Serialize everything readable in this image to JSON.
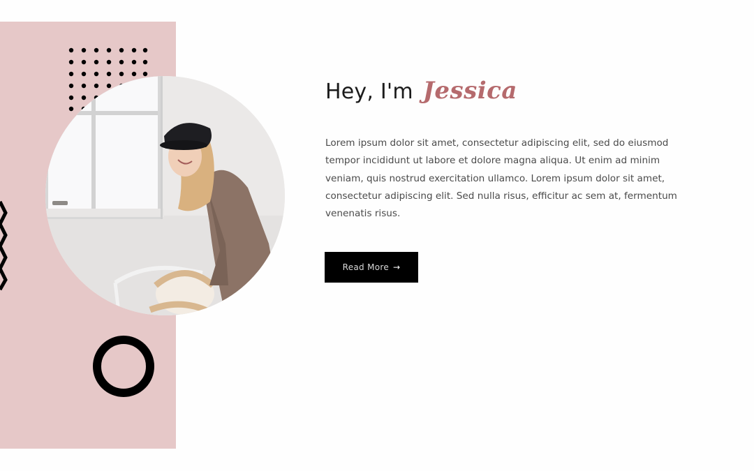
{
  "hero": {
    "greeting": "Hey, I'm",
    "name": "Jessica",
    "bio": "Lorem ipsum dolor sit amet, consectetur adipiscing elit, sed do eiusmod tempor incididunt ut labore et dolore magna aliqua. Ut enim ad minim veniam, quis nostrud exercitation ullamco. Lorem ipsum dolor sit amet, consectetur adipiscing elit. Sed nulla risus, efficitur ac sem at, fermentum venenatis risus.",
    "button_label": "Read More",
    "button_icon": "arrow-right-icon",
    "button_arrow": "→"
  },
  "colors": {
    "panel": "#e6c8c8",
    "accent_name": "#b56a6d",
    "button_bg": "#000000",
    "background": "#fefefe"
  }
}
